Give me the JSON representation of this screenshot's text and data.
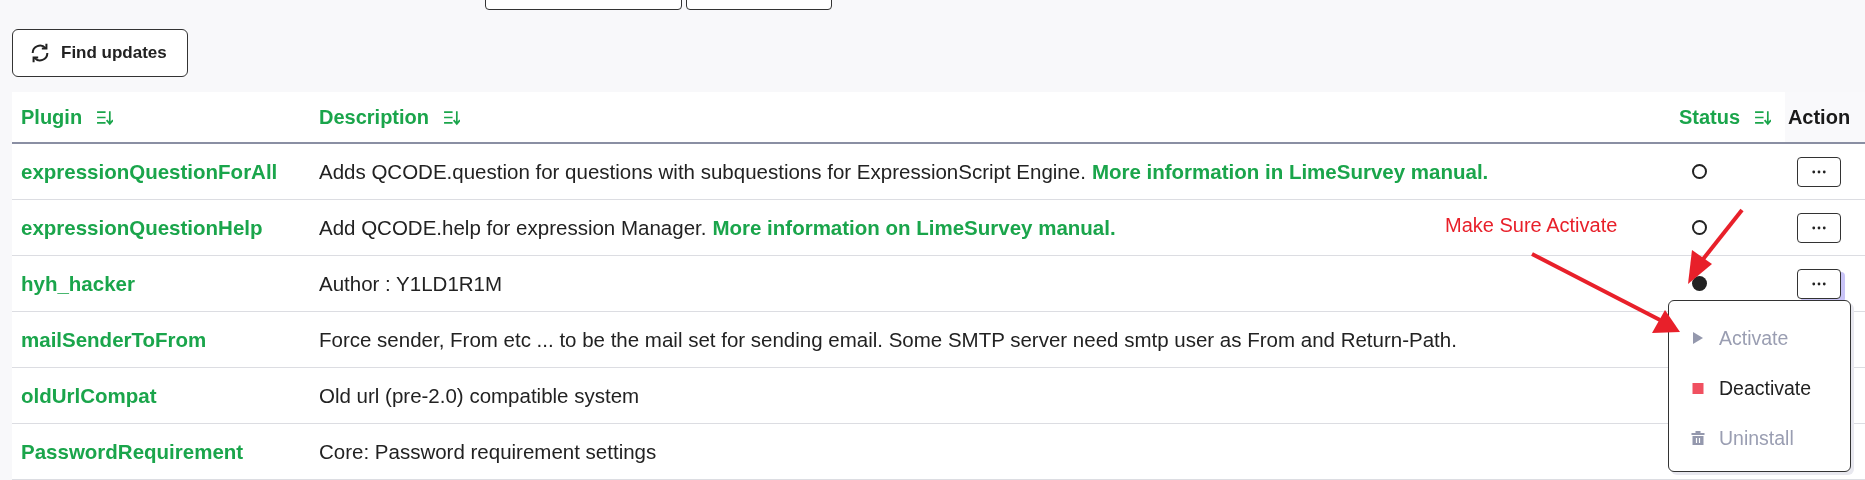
{
  "toolbar": {
    "find_updates": "Find updates"
  },
  "table": {
    "columns": [
      {
        "label": "Plugin",
        "sortable": true,
        "kind": "plugin"
      },
      {
        "label": "Description",
        "sortable": true,
        "kind": "description"
      },
      {
        "label": "Status",
        "sortable": true,
        "kind": "status"
      },
      {
        "label": "Action",
        "sortable": false,
        "kind": "action"
      }
    ],
    "rows": [
      {
        "plugin": "expressionQuestionForAll",
        "description": "Adds QCODE.question for questions with subquestions for ExpressionScript Engine.",
        "link": "More information in LimeSurvey manual.",
        "active": false
      },
      {
        "plugin": "expressionQuestionHelp",
        "description": "Add QCODE.help for expression Manager.",
        "link": "More information on LimeSurvey manual.",
        "active": false
      },
      {
        "plugin": "hyh_hacker",
        "description": "Author : Y1LD1R1M",
        "active": true,
        "focused": true
      },
      {
        "plugin": "mailSenderToFrom",
        "description": "Force sender, From etc ... to be the mail set for sending email. Some SMTP server need smtp user as From and Return-Path."
      },
      {
        "plugin": "oldUrlCompat",
        "description": "Old url (pre-2.0) compatible system"
      },
      {
        "plugin": "PasswordRequirement",
        "description": "Core: Password requirement settings"
      }
    ]
  },
  "action_menu": {
    "items": [
      {
        "label": "Activate",
        "kind": "play",
        "disabled": true
      },
      {
        "label": "Deactivate",
        "kind": "stop",
        "disabled": false
      },
      {
        "label": "Uninstall",
        "kind": "trash",
        "disabled": true
      }
    ]
  },
  "annotation": {
    "text": "Make Sure Activate"
  }
}
